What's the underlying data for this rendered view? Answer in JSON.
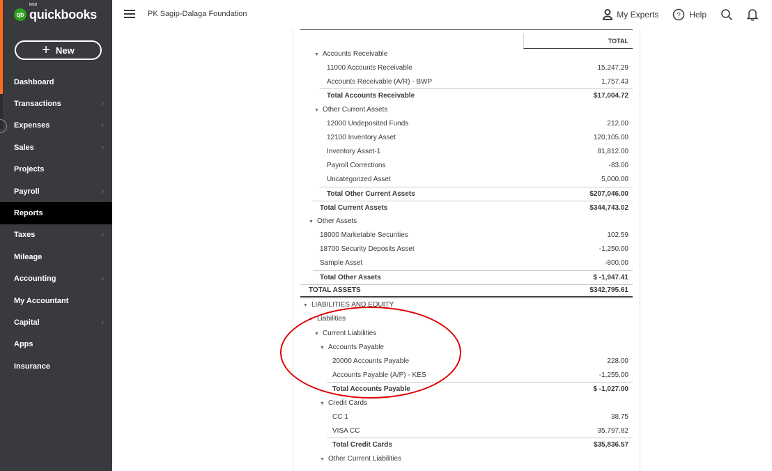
{
  "app": {
    "logo_intuit": "intuit",
    "logo_text": "quickbooks",
    "logo_badge": "qb",
    "brand_color": "#2ca01c",
    "accent_color": "#ff6c1a"
  },
  "sidebar": {
    "new_label": "New",
    "items": [
      {
        "label": "Dashboard",
        "chevron": false
      },
      {
        "label": "Transactions",
        "chevron": true
      },
      {
        "label": "Expenses",
        "chevron": true
      },
      {
        "label": "Sales",
        "chevron": true
      },
      {
        "label": "Projects",
        "chevron": false
      },
      {
        "label": "Payroll",
        "chevron": true
      },
      {
        "label": "Reports",
        "chevron": false,
        "active": true
      },
      {
        "label": "Taxes",
        "chevron": true
      },
      {
        "label": "Mileage",
        "chevron": false
      },
      {
        "label": "Accounting",
        "chevron": true
      },
      {
        "label": "My Accountant",
        "chevron": false
      },
      {
        "label": "Capital",
        "chevron": true
      },
      {
        "label": "Apps",
        "chevron": false
      },
      {
        "label": "Insurance",
        "chevron": false
      }
    ]
  },
  "header": {
    "company_name": "PK Sagip-Dalaga Foundation",
    "my_experts": "My Experts",
    "help": "Help",
    "icons": [
      "menu-icon",
      "experts-icon",
      "help-icon",
      "search-icon",
      "bell-icon"
    ]
  },
  "report": {
    "column_header": "TOTAL",
    "rows": [
      {
        "label": "Accounts Receivable",
        "amount": "",
        "indent": 1,
        "caret": true,
        "style": "head"
      },
      {
        "label": "11000 Accounts Receivable",
        "amount": "15,247.29",
        "indent": 3
      },
      {
        "label": "Accounts Receivable (A/R) - BWP",
        "amount": "1,757.43",
        "indent": 3
      },
      {
        "label": "Total Accounts Receivable",
        "amount": "$17,004.72",
        "indent": 3,
        "style": "total"
      },
      {
        "label": "Other Current Assets",
        "amount": "",
        "indent": 1,
        "caret": true,
        "style": "head"
      },
      {
        "label": "12000 Undeposited Funds",
        "amount": "212.00",
        "indent": 3
      },
      {
        "label": "12100 Inventory Asset",
        "amount": "120,105.00",
        "indent": 3
      },
      {
        "label": "Inventory Asset-1",
        "amount": "81,812.00",
        "indent": 3
      },
      {
        "label": "Payroll Corrections",
        "amount": "-83.00",
        "indent": 3
      },
      {
        "label": "Uncategorized Asset",
        "amount": "5,000.00",
        "indent": 3
      },
      {
        "label": "Total Other Current Assets",
        "amount": "$207,046.00",
        "indent": 3,
        "style": "total"
      },
      {
        "label": "Total Current Assets",
        "amount": "$344,743.02",
        "indent": 2,
        "style": "total"
      },
      {
        "label": "Other Assets",
        "amount": "",
        "indent": 0,
        "caret": true,
        "style": "head"
      },
      {
        "label": "18000 Marketable Securities",
        "amount": "102.59",
        "indent": 2
      },
      {
        "label": "18700 Security Deposits Asset",
        "amount": "-1,250.00",
        "indent": 2
      },
      {
        "label": "Sample Asset",
        "amount": "-800.00",
        "indent": 2
      },
      {
        "label": "Total Other Assets",
        "amount": "$ -1,947.41",
        "indent": 2,
        "style": "total"
      },
      {
        "label": "TOTAL ASSETS",
        "amount": "$342,795.61",
        "indent": 0,
        "style": "grand"
      },
      {
        "label": "LIABILITIES AND EQUITY",
        "amount": "",
        "indent": -1,
        "caret": true,
        "style": "head"
      },
      {
        "label": "Liabilities",
        "amount": "",
        "indent": 0,
        "caret": true,
        "style": "head"
      },
      {
        "label": "Current Liabilities",
        "amount": "",
        "indent": 1,
        "caret": true,
        "style": "head"
      },
      {
        "label": "Accounts Payable",
        "amount": "",
        "indent": 2,
        "caret": true,
        "style": "head"
      },
      {
        "label": "20000 Accounts Payable",
        "amount": "228.00",
        "indent": 4
      },
      {
        "label": "Accounts Payable (A/P) - KES",
        "amount": "-1,255.00",
        "indent": 4
      },
      {
        "label": "Total Accounts Payable",
        "amount": "$ -1,027.00",
        "indent": 4,
        "style": "total"
      },
      {
        "label": "Credit Cards",
        "amount": "",
        "indent": 2,
        "caret": true,
        "style": "head"
      },
      {
        "label": "CC 1",
        "amount": "38.75",
        "indent": 4
      },
      {
        "label": "VISA CC",
        "amount": "35,797.82",
        "indent": 4
      },
      {
        "label": "Total Credit Cards",
        "amount": "$35,836.57",
        "indent": 4,
        "style": "total"
      },
      {
        "label": "Other Current Liabilities",
        "amount": "",
        "indent": 2,
        "caret": true,
        "style": "head"
      }
    ]
  },
  "annotation": {
    "color": "#e00000"
  }
}
